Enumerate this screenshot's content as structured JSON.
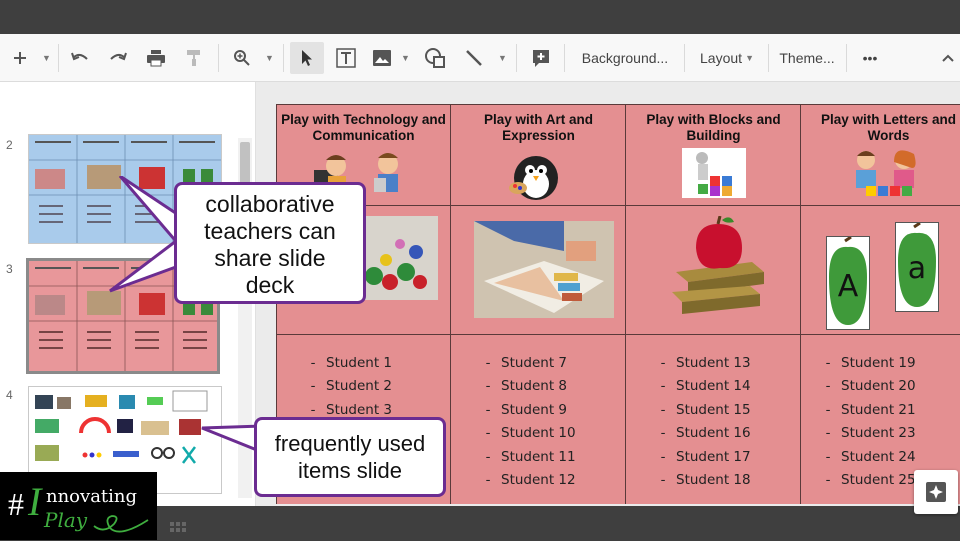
{
  "toolbar": {
    "icons": [
      "add-icon",
      "undo-icon",
      "redo-icon",
      "print-icon",
      "paint-format-icon",
      "zoom-icon",
      "select-icon",
      "textbox-icon",
      "image-icon",
      "shape-icon",
      "line-icon",
      "comment-icon",
      "more-icon",
      "collapse-icon"
    ],
    "background_label": "Background...",
    "layout_label": "Layout",
    "theme_label": "Theme...",
    "more_label": "•••"
  },
  "filmstrip": {
    "slides": [
      {
        "number": "2",
        "color": "#a9cbeb"
      },
      {
        "number": "3",
        "color": "#e8979a",
        "active": true
      },
      {
        "number": "4",
        "color": "#ffffff"
      }
    ]
  },
  "slide": {
    "background": "#e48f91",
    "columns": [
      {
        "title": "Play with Technology and Communication",
        "students": [
          "Student 1",
          "Student 2",
          "Student 3"
        ]
      },
      {
        "title": "Play with Art and Expression",
        "students": [
          "Student 7",
          "Student 8",
          "Student 9",
          "Student 10",
          "Student 11",
          "Student 12"
        ]
      },
      {
        "title": "Play with Blocks and Building",
        "students": [
          "Student 13",
          "Student 14",
          "Student 15",
          "Student 16",
          "Student 17",
          "Student 18"
        ]
      },
      {
        "title": "Play with Letters and Words",
        "students": [
          "Student 19",
          "Student 20",
          "Student 21",
          "Student 23",
          "Student 24",
          "Student 25"
        ]
      }
    ],
    "letters": [
      "A",
      "a"
    ]
  },
  "callouts": {
    "collaborative": "collaborative teachers can share slide deck",
    "frequent": "frequently used items slide"
  },
  "logo": {
    "hash": "#",
    "big_i": "I",
    "word1": "nnovating",
    "word2": "Play"
  },
  "colors": {
    "accent_purple": "#6b2c91",
    "logo_green": "#3fae3f"
  }
}
